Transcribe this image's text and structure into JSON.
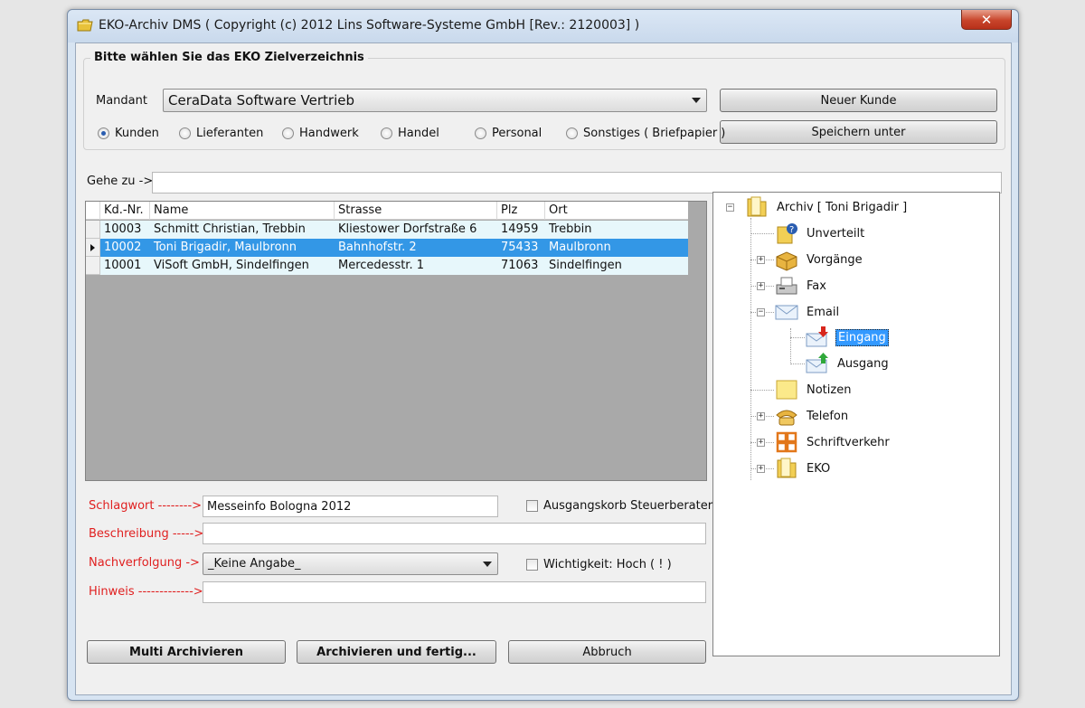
{
  "window": {
    "title": "EKO-Archiv DMS ( Copyright (c) 2012 Lins Software-Systeme GmbH [Rev.: 2120003] )",
    "close_label": "✕"
  },
  "target_group": {
    "title": "Bitte wählen Sie das EKO Zielverzeichnis",
    "mandant_label": "Mandant",
    "mandant_value": "CeraData Software Vertrieb",
    "radios": [
      {
        "label": "Kunden",
        "selected": true
      },
      {
        "label": "Lieferanten",
        "selected": false
      },
      {
        "label": "Handwerk",
        "selected": false
      },
      {
        "label": "Handel",
        "selected": false
      },
      {
        "label": "Personal",
        "selected": false
      },
      {
        "label": "Sonstiges ( Briefpapier )",
        "selected": false
      }
    ],
    "new_customer_label": "Neuer Kunde",
    "save_under_label": "Speichern unter"
  },
  "goto": {
    "label": "Gehe zu ->",
    "value": ""
  },
  "grid": {
    "columns": [
      "Kd.-Nr.",
      "Name",
      "Strasse",
      "Plz",
      "Ort"
    ],
    "rows": [
      {
        "kdnr": "10003",
        "name": "Schmitt Christian, Trebbin",
        "strasse": "Kliestower Dorfstraße 6",
        "plz": "14959",
        "ort": "Trebbin",
        "selected": false
      },
      {
        "kdnr": "10002",
        "name": "Toni Brigadir, Maulbronn",
        "strasse": "Bahnhofstr. 2",
        "plz": "75433",
        "ort": "Maulbronn",
        "selected": true
      },
      {
        "kdnr": "10001",
        "name": "ViSoft GmbH, Sindelfingen",
        "strasse": "Mercedesstr. 1",
        "plz": "71063",
        "ort": "Sindelfingen",
        "selected": false
      }
    ]
  },
  "tree": {
    "root": "Archiv [ Toni Brigadir ]",
    "nodes": {
      "unverteilt": "Unverteilt",
      "vorgaenge": "Vorgänge",
      "fax": "Fax",
      "email": "Email",
      "eingang": "Eingang",
      "ausgang": "Ausgang",
      "notizen": "Notizen",
      "telefon": "Telefon",
      "schriftverkehr": "Schriftverkehr",
      "eko": "EKO"
    }
  },
  "form": {
    "schlagwort_label": "Schlagwort -------->",
    "schlagwort_value": "Messeinfo Bologna 2012",
    "beschreibung_label": "Beschreibung ----->",
    "beschreibung_value": "",
    "nachverfolgung_label": "Nachverfolgung ->",
    "nachverfolgung_value": "_Keine Angabe_",
    "hinweis_label": "Hinweis ------------->",
    "hinweis_value": "",
    "ausgangskorb_label": "Ausgangskorb Steuerberater",
    "wichtigkeit_label": "Wichtigkeit: Hoch ( ! )"
  },
  "actions": {
    "multi_label": "Multi Archivieren",
    "archive_done_label": "Archivieren und fertig...",
    "cancel_label": "Abbruch"
  },
  "colors": {
    "selection": "#3397e6",
    "row_bg": "#e7f7fb",
    "red_label": "#e02020"
  }
}
